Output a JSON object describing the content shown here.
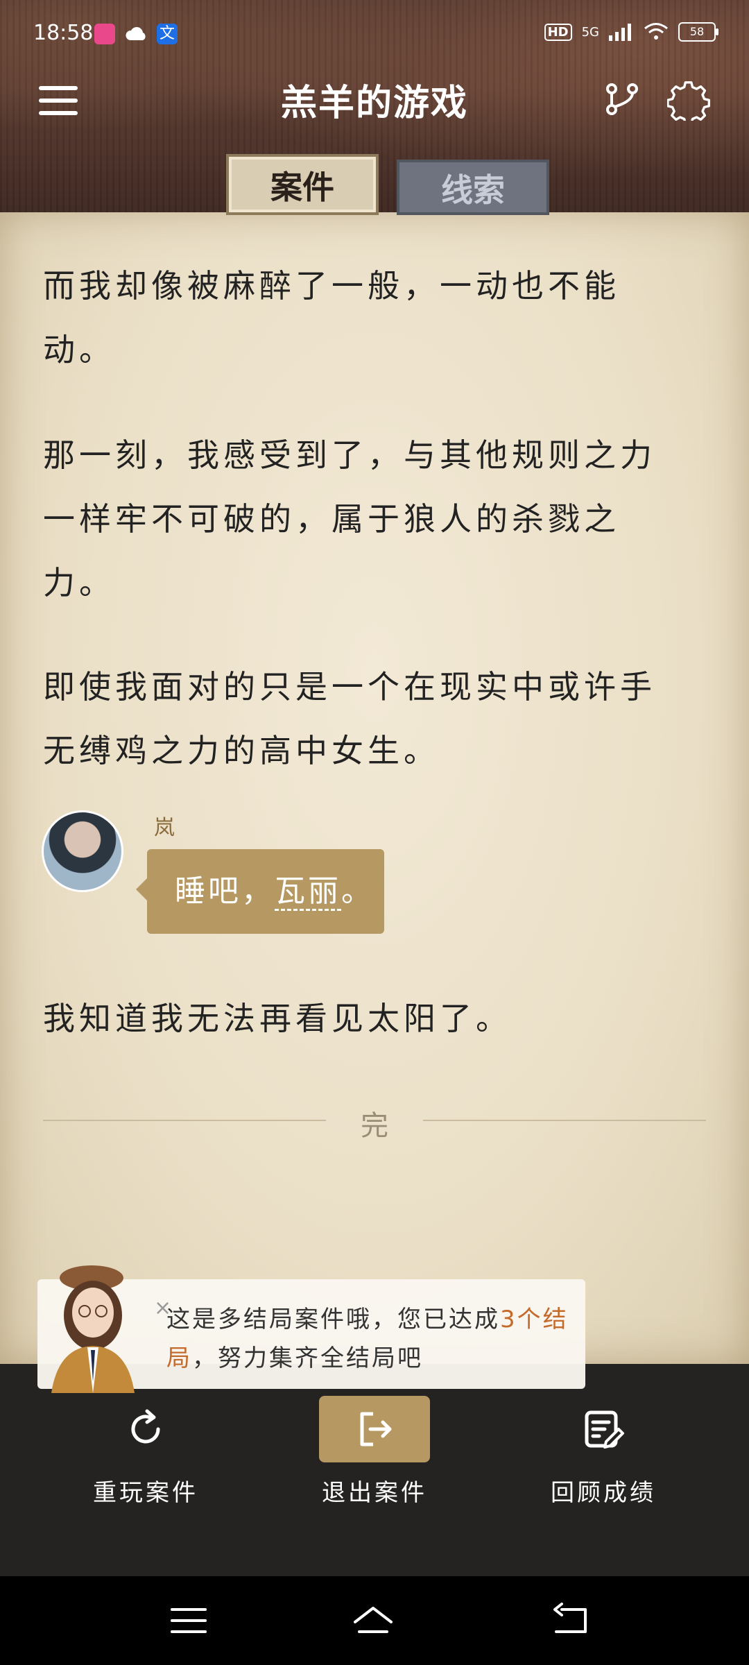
{
  "status_bar": {
    "time": "18:58",
    "app_icons": [
      "lofter-app-icon",
      "cloud-app-icon",
      "translate-app-icon"
    ],
    "translate_icon_glyph": "文",
    "hd_label": "HD",
    "network": "5G",
    "battery": "58"
  },
  "header": {
    "title": "羔羊的游戏",
    "tabs": [
      {
        "label": "案件",
        "active": true
      },
      {
        "label": "线索",
        "active": false
      }
    ]
  },
  "story": {
    "paragraphs": [
      "而我却像被麻醉了一般，一动也不能动。",
      "那一刻，我感受到了，与其他规则之力一样牢不可破的，属于狼人的杀戮之力。",
      "即使我面对的只是一个在现实中或许手无缚鸡之力的高中女生。",
      "我知道我无法再看见太阳了。"
    ],
    "dialogue": {
      "speaker": "岚",
      "text_before": "睡吧，",
      "text_name": "瓦丽",
      "text_after": "。"
    },
    "end_label": "完"
  },
  "tip": {
    "close": "×",
    "text_before": "这是多结局案件哦，您已达成",
    "highlight": "3个结局",
    "text_after": "，努力集齐全结局吧"
  },
  "actions": [
    {
      "label": "重玩案件",
      "icon": "replay-icon"
    },
    {
      "label": "退出案件",
      "icon": "exit-icon"
    },
    {
      "label": "回顾成绩",
      "icon": "review-icon"
    }
  ],
  "colors": {
    "accent_gold": "#b59862",
    "highlight_orange": "#c46a2b",
    "paper": "#ede3cc",
    "dark_bar": "#242322"
  }
}
